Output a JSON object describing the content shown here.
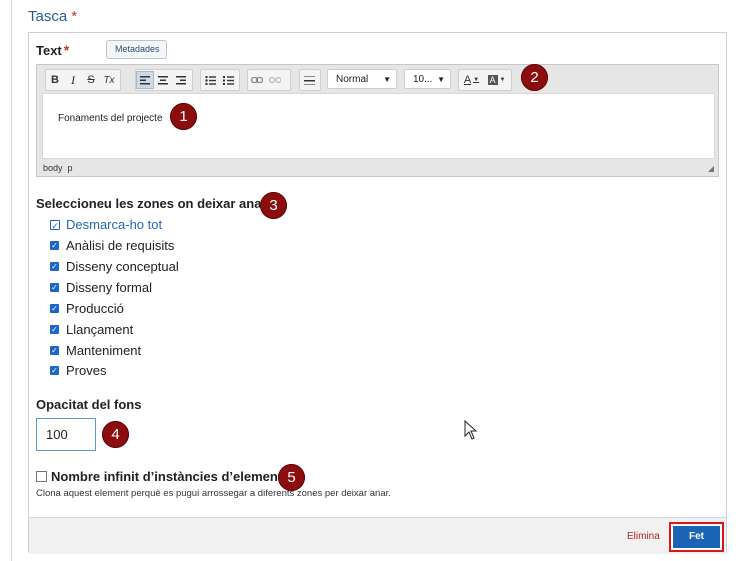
{
  "section": {
    "title": "Tasca",
    "required": "*"
  },
  "text_field": {
    "label": "Text",
    "required": "*",
    "metadata_tag": "Metadades"
  },
  "toolbar": {
    "bold": "B",
    "italic": "I",
    "strike": "S",
    "clear": "Tx",
    "format_value": "Normal",
    "size_value": "10...",
    "text_color": "A",
    "bg_color": "A"
  },
  "editor": {
    "content": "Fonaments del projecte",
    "path_body": "body",
    "path_p": "p"
  },
  "zones": {
    "label": "Seleccioneu les zones on deixar anar",
    "deselect_all": "Desmarca-ho tot",
    "items": [
      "Anàlisi de requisits",
      "Disseny conceptual",
      "Disseny formal",
      "Producció",
      "Llançament",
      "Manteniment",
      "Proves"
    ]
  },
  "opacity": {
    "label": "Opacitat del fons",
    "value": "100"
  },
  "infinite": {
    "label": "Nombre infinit d’instàncies d’elements",
    "help": "Clona aquest element perquè es pugui arrossegar a diferents zones per deixar anar."
  },
  "footer": {
    "delete": "Elimina",
    "done": "Fet"
  },
  "badges": [
    "1",
    "2",
    "3",
    "4",
    "5"
  ],
  "colors": {
    "accent": "#1a63b5",
    "badge": "#8c0d0d",
    "title": "#2a5d8f",
    "danger": "#b3261e"
  }
}
